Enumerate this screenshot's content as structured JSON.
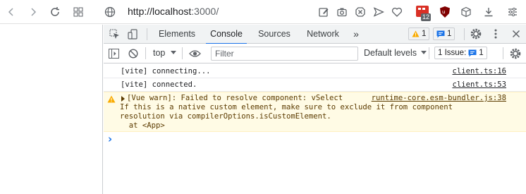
{
  "browser": {
    "url_scheme_host": "http://localhost",
    "url_port_path": ":3000/",
    "ext_badge_count": "12"
  },
  "devtools": {
    "tabs": [
      "Elements",
      "Console",
      "Sources",
      "Network"
    ],
    "active_tab": "Console",
    "warning_count": "1",
    "message_count": "1",
    "context": "top",
    "filter_placeholder": "Filter",
    "levels": "Default levels",
    "issues_label": "1 Issue:",
    "issues_count": "1"
  },
  "console": {
    "lines": [
      {
        "text": "[vite] connecting...",
        "source": "client.ts:16"
      },
      {
        "text": "[vite] connected.",
        "source": "client.ts:53"
      }
    ],
    "warning": {
      "head": "[Vue warn]: Failed to resolve component: vSelect",
      "source": "runtime-core.esm-bundler.js:38",
      "line2": "If this is a native custom element, make sure to exclude it from component",
      "line3": "resolution via compilerOptions.isCustomElement.",
      "line4": "  at <App>"
    },
    "prompt": "›"
  },
  "colors": {
    "accent": "#1a73e8",
    "warning_bg": "#fffbe5",
    "warning_icon": "#f9ab00"
  }
}
